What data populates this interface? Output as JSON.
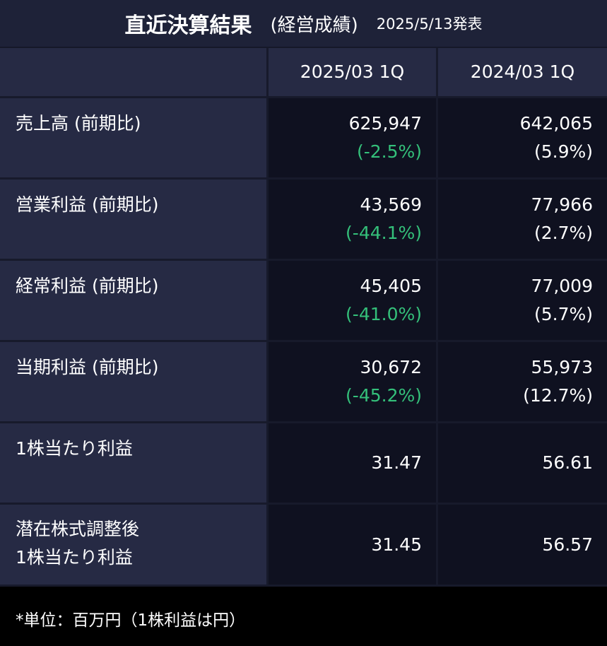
{
  "header": {
    "title": "直近決算結果",
    "subtitle": "(経営成績)",
    "announce_date": "2025/5/13発表"
  },
  "columns": [
    "2025/03 1Q",
    "2024/03 1Q"
  ],
  "rows": [
    {
      "label": "売上高 (前期比)",
      "c1": {
        "value": "625,947",
        "change": "(-2.5%)"
      },
      "c2": {
        "value": "642,065",
        "change": "(5.9%)"
      }
    },
    {
      "label": "営業利益 (前期比)",
      "c1": {
        "value": "43,569",
        "change": "(-44.1%)"
      },
      "c2": {
        "value": "77,966",
        "change": "(2.7%)"
      }
    },
    {
      "label": "経常利益 (前期比)",
      "c1": {
        "value": "45,405",
        "change": "(-41.0%)"
      },
      "c2": {
        "value": "77,009",
        "change": "(5.7%)"
      }
    },
    {
      "label": "当期利益 (前期比)",
      "c1": {
        "value": "30,672",
        "change": "(-45.2%)"
      },
      "c2": {
        "value": "55,973",
        "change": "(12.7%)"
      }
    },
    {
      "label": "1株当たり利益",
      "c1": {
        "value": "31.47"
      },
      "c2": {
        "value": "56.61"
      }
    },
    {
      "label_line1": "潜在株式調整後",
      "label_line2": "1株当たり利益",
      "c1": {
        "value": "31.45"
      },
      "c2": {
        "value": "56.57"
      }
    }
  ],
  "footer": {
    "note": "*単位：百万円（1株利益は円）"
  },
  "colors": {
    "negative": "#34c07a",
    "label_bg": "#262a44",
    "value_bg": "#0f1120"
  }
}
